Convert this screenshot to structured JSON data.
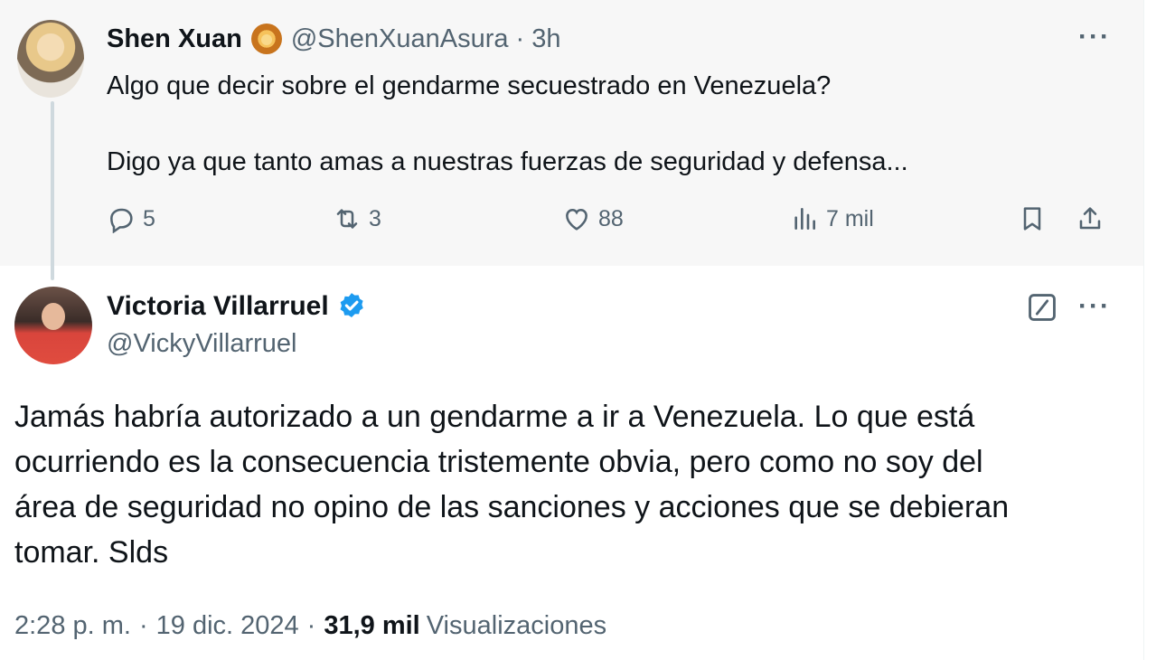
{
  "parent_tweet": {
    "author_name": "Shen Xuan",
    "author_emoji_icon": "lion-face-icon",
    "handle": "@ShenXuanAsura",
    "separator": "·",
    "time": "3h",
    "more": "···",
    "text_lines": [
      "Algo que decir sobre el gendarme secuestrado en Venezuela?",
      "Digo ya que tanto amas a nuestras fuerzas de seguridad y defensa..."
    ],
    "actions": {
      "replies": "5",
      "reposts": "3",
      "likes": "88",
      "views": "7 mil"
    }
  },
  "main_tweet": {
    "author_name": "Victoria Villarruel",
    "verified_icon": "verified-badge-icon",
    "handle": "@VickyVillarruel",
    "more": "···",
    "text_lines": [
      "Jamás habría autorizado a un gendarme a ir a Venezuela. Lo que está",
      "ocurriendo es la consecuencia tristemente obvia, pero como no soy del",
      "área de seguridad no opino de las sanciones y acciones que se debieran",
      "tomar. Slds"
    ],
    "meta": {
      "time": "2:28 p. m.",
      "sep1": "·",
      "date": "19 dic. 2024",
      "sep2": "·",
      "views_count": "31,9 mil",
      "views_label": "Visualizaciones"
    }
  },
  "colors": {
    "text_primary": "#0f1419",
    "text_secondary": "#536471",
    "verified_blue": "#1d9bf0",
    "parent_background": "#f7f7f7",
    "thread_line": "#cfd9de"
  }
}
